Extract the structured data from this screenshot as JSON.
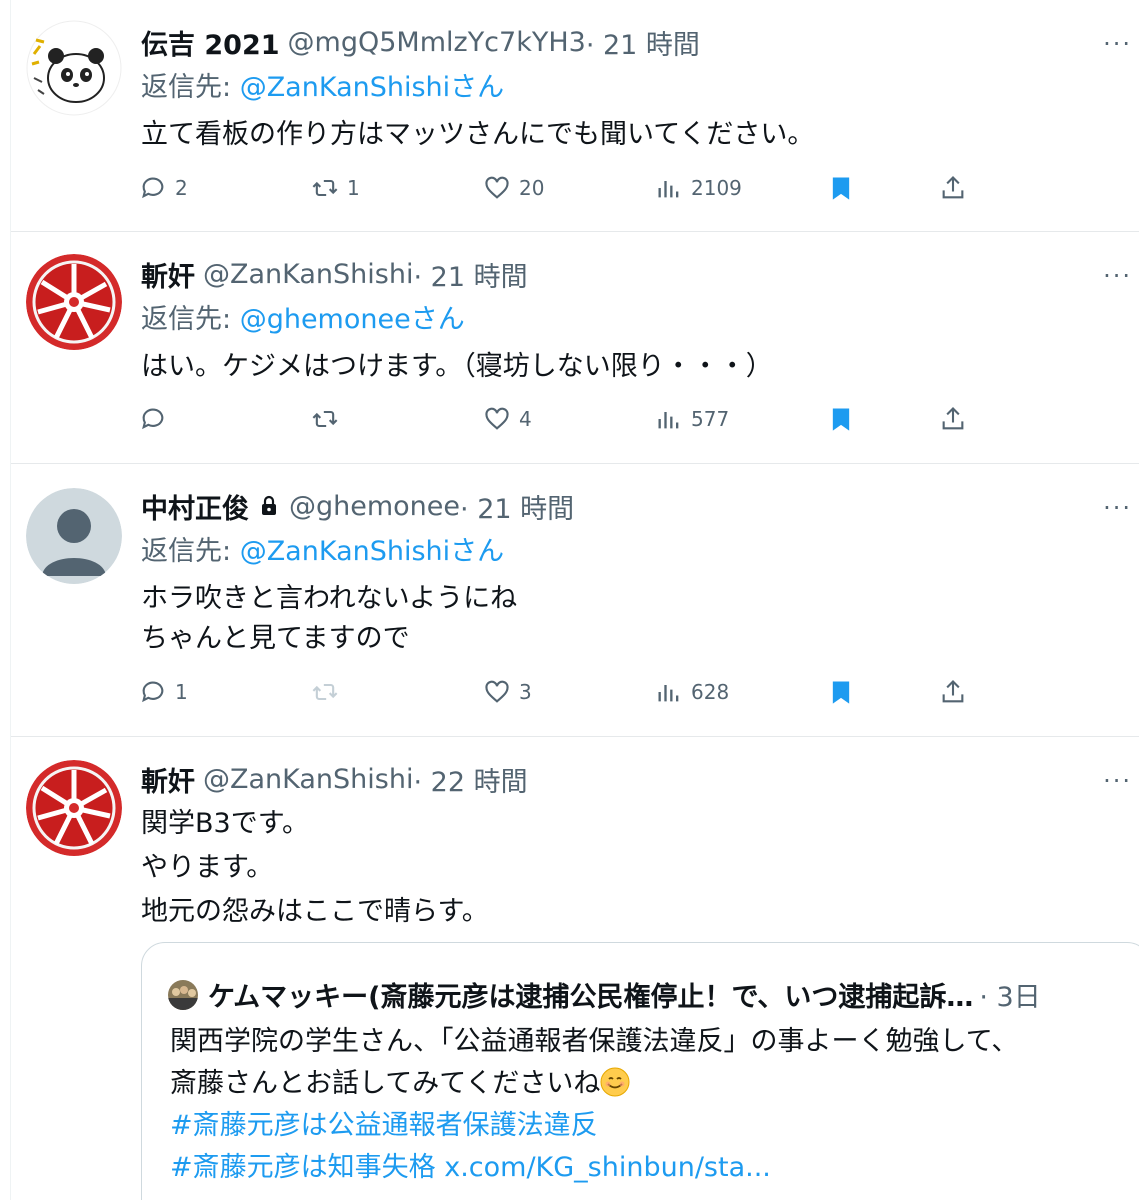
{
  "tweets": [
    {
      "name": "伝吉 2021",
      "handle": "@mgQ5MmlzYc7kYH3",
      "time": "· 21 時間",
      "reply_prefix": "返信先: ",
      "reply_to": "@ZanKanShishi",
      "reply_suffix": "さん",
      "lines": [
        "立て看板の作り方はマッツさんにでも聞いてください。"
      ],
      "replies": "2",
      "retweets": "1",
      "likes": "20",
      "views": "2109",
      "avatar_icon": "panda-sketch-avatar"
    },
    {
      "name": "斬奸",
      "handle": "@ZanKanShishi",
      "time": "· 21 時間",
      "reply_prefix": "返信先: ",
      "reply_to": "@ghemonee",
      "reply_suffix": "さん",
      "lines": [
        "はい。ケジメはつけます。（寝坊しない限り・・・）"
      ],
      "replies": "",
      "retweets": "",
      "likes": "4",
      "views": "577",
      "avatar_icon": "red-candy-tin-avatar"
    },
    {
      "name": "中村正俊",
      "handle": "@ghemonee",
      "time": "· 21 時間",
      "reply_prefix": "返信先: ",
      "reply_to": "@ZanKanShishi",
      "reply_suffix": "さん",
      "lines": [
        "ホラ吹きと言われないようにね",
        "ちゃんと見てますので"
      ],
      "replies": "1",
      "retweets": "",
      "likes": "3",
      "views": "628",
      "avatar_icon": "default-person-avatar"
    },
    {
      "name": "斬奸",
      "handle": "@ZanKanShishi",
      "time": "· 22 時間",
      "lines": [
        "関学B3です。",
        "やります。",
        "地元の怨みはここで晴らす。"
      ],
      "avatar_icon": "red-candy-tin-avatar"
    }
  ],
  "quote": {
    "name": "ケムマッキー(斎藤元彦は逮捕公民権停止！で、いつ逮捕起訴…",
    "time": "· 3日",
    "line1": "関西学院の学生さん、「公益通報者保護法違反」の事よーく勉強して、",
    "line2": "斎藤さんとお話してみてくださいね",
    "hashtag1": "#斎藤元彦は公益通報者保護法違反",
    "hashtag2": "#斎藤元彦は知事失格",
    "link": "x.com/KG_shinbun/sta..."
  },
  "more_label": "···",
  "colors": {
    "accent": "#1d9bf0",
    "secondary_text": "#536471",
    "primary_text": "#0f1419",
    "divider": "#e6e9eb"
  }
}
